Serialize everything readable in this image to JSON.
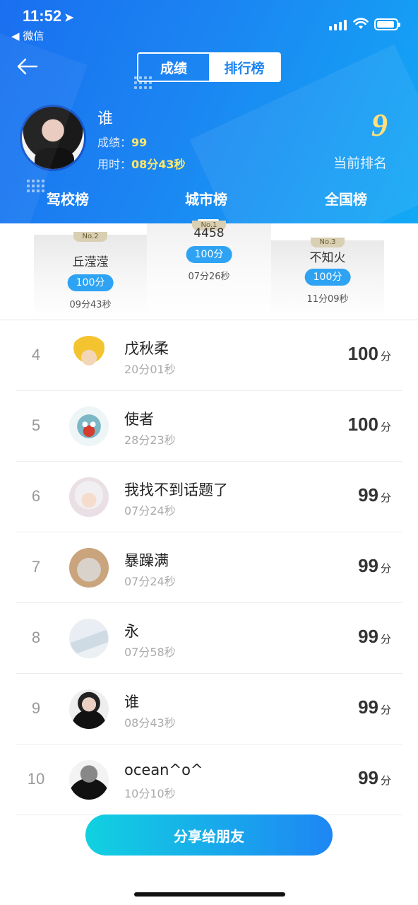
{
  "status": {
    "time": "11:52",
    "back_app": "微信"
  },
  "segment": {
    "tab_score": "成绩",
    "tab_rank": "排行榜"
  },
  "me": {
    "name": "谁",
    "score_label": "成绩：",
    "score": "99",
    "time_label": "用时：",
    "time": "08分43秒",
    "rank": "9",
    "rank_label": "当前排名"
  },
  "tabs": [
    "驾校榜",
    "城市榜",
    "全国榜"
  ],
  "podium": [
    {
      "name": "丘滢滢",
      "score": "100分",
      "time": "09分43秒",
      "badge": "No.2"
    },
    {
      "name": "4458",
      "score": "100分",
      "time": "07分26秒",
      "badge": "No.1"
    },
    {
      "name": "不知火",
      "score": "100分",
      "time": "11分09秒",
      "badge": "No.3"
    }
  ],
  "list": [
    {
      "rank": "4",
      "name": "戊秋柔",
      "time": "20分01秒",
      "score": "100",
      "unit": "分",
      "avatar": "anime-blonde"
    },
    {
      "rank": "5",
      "name": "使者",
      "time": "28分23秒",
      "score": "100",
      "unit": "分",
      "avatar": "blue-monster"
    },
    {
      "rank": "6",
      "name": "我找不到话题了",
      "time": "07分24秒",
      "score": "99",
      "unit": "分",
      "avatar": "anime-white-hair"
    },
    {
      "rank": "7",
      "name": "暴躁满",
      "time": "07分24秒",
      "score": "99",
      "unit": "分",
      "avatar": "cat"
    },
    {
      "rank": "8",
      "name": "永",
      "time": "07分58秒",
      "score": "99",
      "unit": "分",
      "avatar": "landscape"
    },
    {
      "rank": "9",
      "name": "谁",
      "time": "08分43秒",
      "score": "99",
      "unit": "分",
      "avatar": "woman-photo"
    },
    {
      "rank": "10",
      "name": "ocean^o^",
      "time": "10分10秒",
      "score": "99",
      "unit": "分",
      "avatar": "person-steady"
    }
  ],
  "share_label": "分享给朋友",
  "colors": {
    "primary": "#1d84f1",
    "accent_yellow": "#ffe07a",
    "badge_blue": "#2fa3f3",
    "share_start": "#11d1e0",
    "share_end": "#1e86f4"
  }
}
